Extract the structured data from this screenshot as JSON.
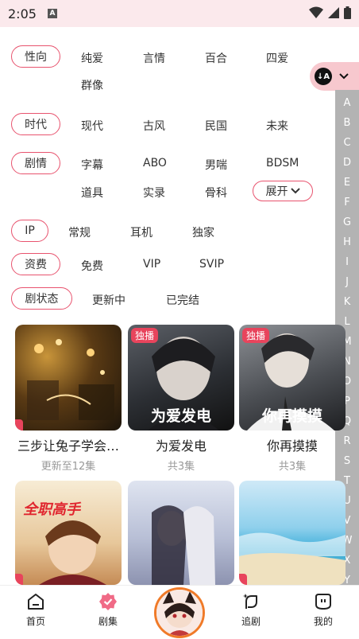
{
  "status": {
    "time": "2:05",
    "app_glyph": "A"
  },
  "filters": {
    "rows": [
      {
        "label": "性向",
        "options": [
          "纯爱",
          "言情",
          "百合",
          "四爱",
          "群像"
        ]
      },
      {
        "label": "时代",
        "options": [
          "现代",
          "古风",
          "民国",
          "未来"
        ]
      },
      {
        "label": "剧情",
        "options": [
          "字幕",
          "ABO",
          "男喘",
          "BDSM",
          "道具",
          "实录",
          "骨科"
        ]
      },
      {
        "label": "IP",
        "options": [
          "常规",
          "耳机",
          "独家"
        ]
      },
      {
        "label": "资费",
        "options": [
          "免费",
          "VIP",
          "SVIP"
        ]
      },
      {
        "label": "剧状态",
        "options": [
          "更新中",
          "已完结"
        ]
      }
    ],
    "expand_label": "展开"
  },
  "sort": {
    "icon": "sort-az-icon",
    "chevron": "chevron-down-icon"
  },
  "az_index": [
    "A",
    "B",
    "C",
    "D",
    "E",
    "F",
    "G",
    "H",
    "I",
    "J",
    "K",
    "L",
    "M",
    "N",
    "O",
    "P",
    "Q",
    "R",
    "S",
    "T",
    "U",
    "V",
    "W",
    "X",
    "Y"
  ],
  "cards": [
    {
      "title": "三步让兔子学会…",
      "sub": "更新至12集",
      "badge": ""
    },
    {
      "title": "为爱发电",
      "sub": "共3集",
      "badge": "独播",
      "cover_text": "为爱发电"
    },
    {
      "title": "你再摸摸",
      "sub": "共3集",
      "badge": "独播",
      "cover_text": "你再摸摸"
    },
    {
      "title": "",
      "sub": "",
      "badge": "",
      "cover_text": "全职高手"
    },
    {
      "title": "",
      "sub": "",
      "badge": ""
    },
    {
      "title": "",
      "sub": "",
      "badge": ""
    }
  ],
  "nav": {
    "home": "首页",
    "series": "剧集",
    "follow": "追剧",
    "mine": "我的"
  },
  "colors": {
    "accent": "#e8536e",
    "badge": "#e8445c",
    "status_bg": "#fbe9ec",
    "index_bg": "#b3b3b3",
    "avatar_ring": "#f07a28"
  }
}
